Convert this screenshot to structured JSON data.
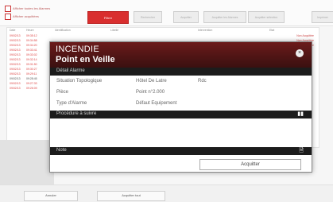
{
  "background": {
    "checkbox_labels": [
      "Afficher toutes les Alarmes",
      "Afficher acquittées"
    ],
    "filter_button": "Filtrer",
    "toolbar_buttons": [
      "Rechercher",
      "Acquitter",
      "Acquitter les Alarmes",
      "Acquitter sélection",
      "Imprimer"
    ],
    "table_headers": [
      "Date",
      "Heure",
      "Identification",
      "Libellé",
      "Intervention",
      "Etat"
    ],
    "rows": [
      {
        "date": "09/02/13",
        "time": "09:35:12"
      },
      {
        "date": "09/02/13",
        "time": "09:34:58"
      },
      {
        "date": "09/02/13",
        "time": "09:34:20"
      },
      {
        "date": "09/02/13",
        "time": "09:33:41"
      },
      {
        "date": "09/02/13",
        "time": "09:33:02"
      },
      {
        "date": "09/02/13",
        "time": "09:32:14"
      },
      {
        "date": "09/02/13",
        "time": "09:31:50"
      },
      {
        "date": "09/02/13",
        "time": "09:30:27"
      },
      {
        "date": "09/02/13",
        "time": "09:29:11"
      },
      {
        "date": "09/02/13",
        "time": "09:28:45"
      },
      {
        "date": "09/02/13",
        "time": "09:27:33"
      },
      {
        "date": "09/02/13",
        "time": "09:26:09"
      }
    ],
    "state_texts": [
      "Non Acquittée",
      "Non Acquittée",
      "Non Acquittée"
    ],
    "footer_buttons": [
      "Annuler",
      "Acquitter tout"
    ]
  },
  "modal": {
    "category": "INCENDIE",
    "title": "Point en Veille",
    "close_icon_glyph": "×",
    "detail_section": "Détail Alarme",
    "details": [
      {
        "label": "Situation Topologique",
        "value": "Hôtel De Latre",
        "value2": "Rdc"
      },
      {
        "label": "Pièce",
        "value": "Point n°2.000",
        "value2": ""
      },
      {
        "label": "Type d'Alarme",
        "value": "Défaut Equipement",
        "value2": ""
      }
    ],
    "procedure_section": "Procédure à suivre",
    "procedure_icon_glyph": "▮▮",
    "note_section": "Note",
    "note_icon_glyph": "🗎",
    "acknowledge_button": "Acquitter"
  },
  "colors": {
    "header_red": "#6b1b1b",
    "section_bar": "#1c1c1c",
    "accent_red": "#d92f2f"
  }
}
